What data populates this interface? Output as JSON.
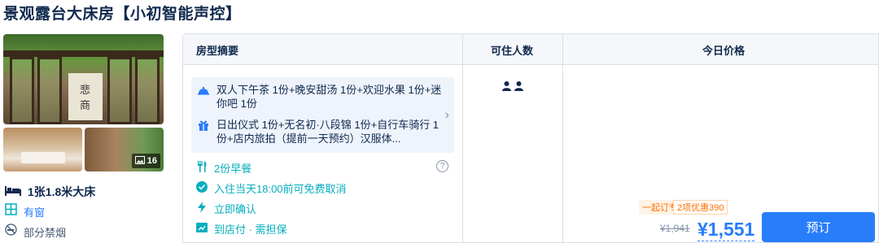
{
  "room": {
    "title": "景观露台大床房【小初智能声控】",
    "photo_count": "16",
    "photo_sign": "悲 商",
    "facts": {
      "bed": "1张1.8米大床",
      "window": "有窗",
      "smoking": "部分禁烟"
    }
  },
  "table": {
    "headers": {
      "summary": "房型摘要",
      "guests": "可住人数",
      "price": "今日价格"
    },
    "package": {
      "line1": "双人下午茶 1份+晚安甜汤 1份+欢迎水果 1份+迷你吧 1份",
      "line2": "日出仪式 1份+无名初·八段锦 1份+自行车骑行 1份+店内旅拍（提前一天预约）汉服体..."
    },
    "policies": {
      "breakfast": "2份早餐",
      "cancel": "入住当天18:00前可免费取消",
      "confirm": "立即确认",
      "payment": "到店付 · 需担保"
    },
    "guest_count": 2,
    "price": {
      "promo_label": "一起订专享",
      "promo_discount": "2项优惠390",
      "original": "¥1,941",
      "current": "¥1,551",
      "book_label": "预订"
    }
  },
  "colors": {
    "accent": "#287dfa",
    "teal": "#06aebd",
    "promo": "#ff6f00",
    "text": "#0f294d"
  },
  "icons": {
    "photo_badge": "image-icon",
    "bed": "bed-icon",
    "window": "window-icon",
    "smoking": "no-smoking-icon",
    "package_1": "dining-cloche-icon",
    "package_2": "gift-icon",
    "breakfast": "utensils-icon",
    "cancel": "check-circle-icon",
    "confirm": "lightning-icon",
    "payment": "pay-at-hotel-icon",
    "help": "question-icon",
    "guests": "person-icon"
  }
}
